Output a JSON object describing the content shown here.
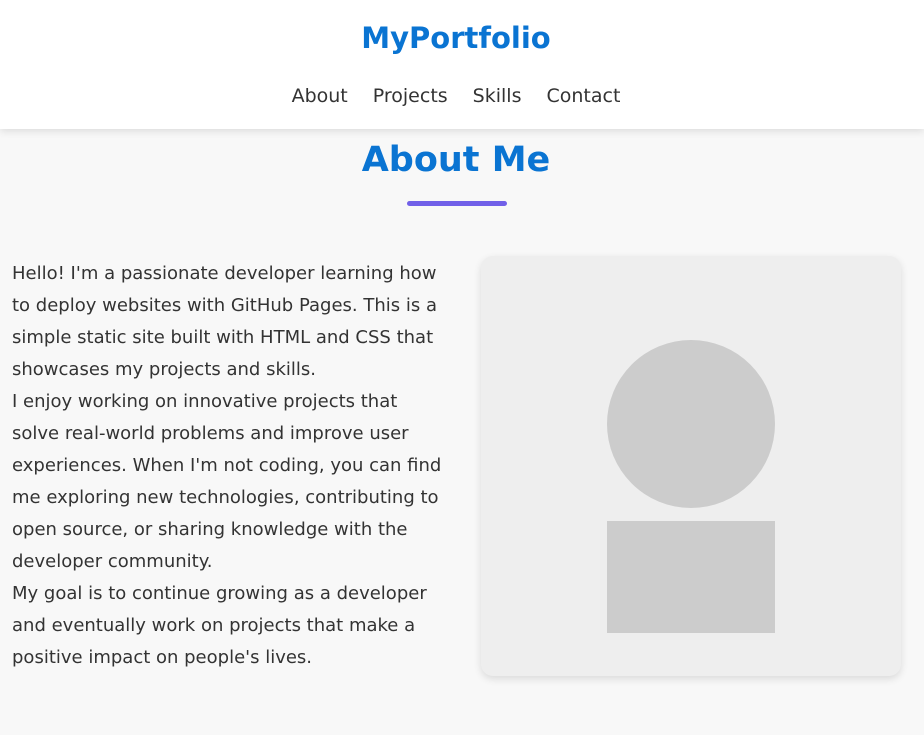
{
  "header": {
    "logo": "MyPortfolio",
    "nav": [
      {
        "label": "About"
      },
      {
        "label": "Projects"
      },
      {
        "label": "Skills"
      },
      {
        "label": "Contact"
      }
    ]
  },
  "about": {
    "title": "About Me",
    "paragraphs": [
      "Hello! I'm a passionate developer learning how to deploy websites with GitHub Pages. This is a simple static site built with HTML and CSS that showcases my projects and skills.",
      "I enjoy working on innovative projects that solve real-world problems and improve user experiences. When I'm not coding, you can find me exploring new technologies, contributing to open source, or sharing knowledge with the developer community.",
      "My goal is to continue growing as a developer and eventually work on projects that make a positive impact on people's lives."
    ]
  },
  "colors": {
    "brand": "#0a74d2",
    "accent": "#7160e8",
    "placeholder": "#cccccc"
  },
  "icons": {
    "profile_image": "profile-placeholder-icon"
  }
}
